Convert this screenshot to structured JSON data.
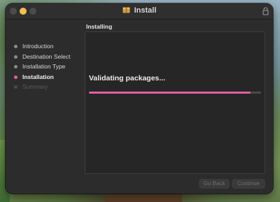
{
  "window": {
    "title": "Install"
  },
  "section_title": "Installing",
  "sidebar": {
    "steps": [
      {
        "label": "Introduction",
        "state": "done"
      },
      {
        "label": "Destination Select",
        "state": "done"
      },
      {
        "label": "Installation Type",
        "state": "done"
      },
      {
        "label": "Installation",
        "state": "active"
      },
      {
        "label": "Summary",
        "state": "pending"
      }
    ]
  },
  "status": {
    "message": "Validating packages...",
    "progress": 0.94
  },
  "buttons": {
    "back": "Go Back",
    "continue": "Continue"
  },
  "colors": {
    "accent": "#e060a0",
    "active_dot": "#e85ca0",
    "minimize_button": "#f5bf4f"
  },
  "icons": {
    "title": "package-icon",
    "lock": "lock-icon"
  }
}
